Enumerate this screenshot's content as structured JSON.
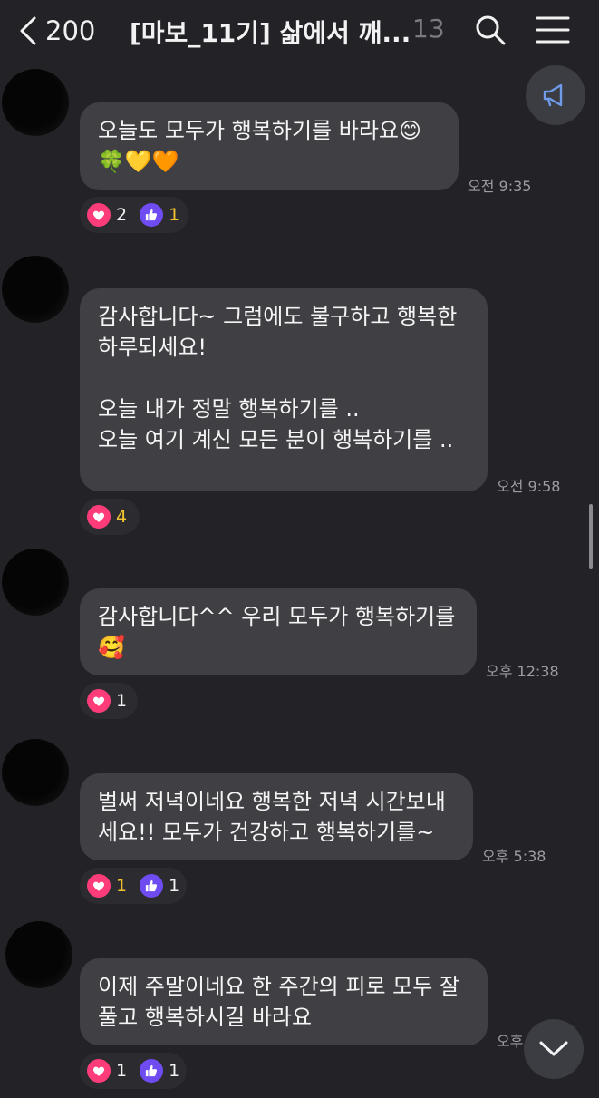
{
  "header": {
    "back_count": "200",
    "title": "[마보_11기] 삶에서 깨...",
    "member_count": "13"
  },
  "messages": [
    {
      "text": "오늘도 모두가 행복하기를 바라요😊\n🍀💛🧡",
      "time": "오전 9:35",
      "reactions": [
        {
          "icon": "heart-icon",
          "count": "2"
        },
        {
          "icon": "thumbs-up-icon",
          "count": "1"
        }
      ]
    },
    {
      "text": "감사합니다~ 그럼에도 불구하고 행복한\n하루되세요!\n\n오늘 내가 정말 행복하기를 ..\n오늘 여기 계신 모든 분이 행복하기를 ..",
      "time": "오전 9:58",
      "reactions": [
        {
          "icon": "heart-icon",
          "count": "4"
        }
      ]
    },
    {
      "text": "감사합니다^^ 우리 모두가 행복하기를\n🥰",
      "time": "오후 12:38",
      "reactions": [
        {
          "icon": "heart-icon",
          "count": "1"
        }
      ]
    },
    {
      "text": "벌써 저녁이네요 행복한 저녁 시간보내\n세요!! 모두가 건강하고 행복하기를~",
      "time": "오후 5:38",
      "reactions": [
        {
          "icon": "heart-icon",
          "count": "1"
        },
        {
          "icon": "thumbs-up-icon",
          "count": "1"
        }
      ]
    },
    {
      "text": "이제 주말이네요 한 주간의 피로 모두 잘\n풀고 행복하시길 바라요",
      "time": "오후",
      "reactions": [
        {
          "icon": "heart-icon",
          "count": "1"
        },
        {
          "icon": "thumbs-up-icon",
          "count": "1"
        }
      ]
    }
  ],
  "colors": {
    "background": "#232327",
    "bubble": "#404044",
    "heart": "#ff3c7a",
    "thumbs_up": "#6f4cf2",
    "mine_count": "#f2c230"
  }
}
